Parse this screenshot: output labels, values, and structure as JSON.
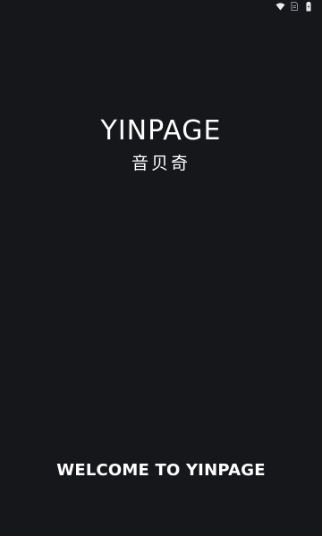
{
  "status_bar": {
    "icons": [
      "wifi-icon",
      "sim-card-icon",
      "battery-icon"
    ]
  },
  "brand": {
    "name_en": "YINPAGE",
    "name_cn": "音贝奇"
  },
  "footer": {
    "welcome_text": "WELCOME TO YINPAGE"
  },
  "colors": {
    "background": "#15171b",
    "text": "#ffffff",
    "status_icon": "#e9ecef"
  }
}
